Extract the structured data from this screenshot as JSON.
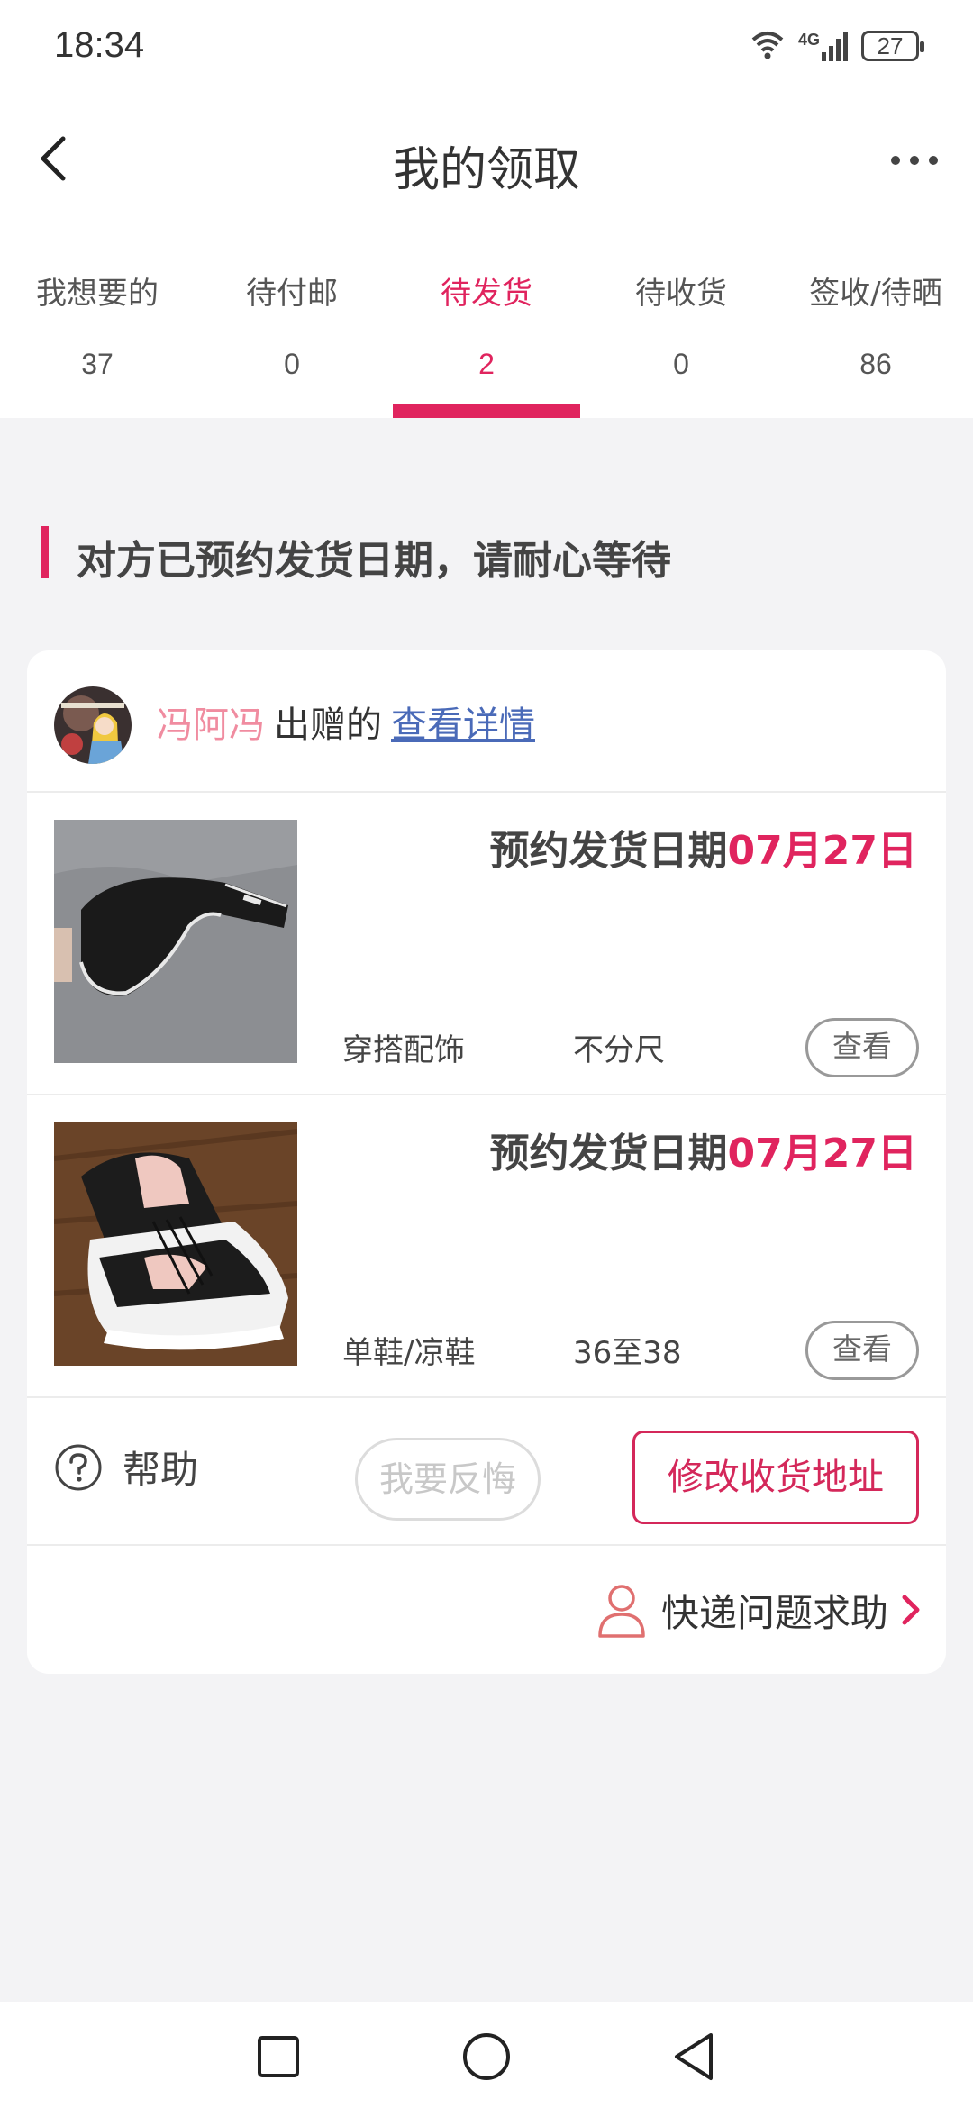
{
  "status_bar": {
    "time": "18:34",
    "network": "4G",
    "battery": "27"
  },
  "header": {
    "title": "我的领取"
  },
  "tabs": [
    {
      "label": "我想要的",
      "count": "37"
    },
    {
      "label": "待付邮",
      "count": "0"
    },
    {
      "label": "待发货",
      "count": "2",
      "active": true
    },
    {
      "label": "待收货",
      "count": "0"
    },
    {
      "label": "签收/待晒",
      "count": "86"
    }
  ],
  "notice": "对方已预约发货日期，请耐心等待",
  "card": {
    "giver_name": "冯阿冯",
    "giver_text": "出赠的",
    "detail_link": "查看详情",
    "items": [
      {
        "date_label": "预约发货日期",
        "date_value": "07月27日",
        "category": "穿搭配饰",
        "size": "不分尺",
        "view_label": "查看",
        "thumb_icon": "visor-cap-photo"
      },
      {
        "date_label": "预约发货日期",
        "date_value": "07月27日",
        "category": "单鞋/凉鞋",
        "size": "36至38",
        "view_label": "查看",
        "thumb_icon": "sneakers-photo"
      }
    ],
    "help_label": "帮助",
    "regret_label": "我要反悔",
    "address_label": "修改收货地址",
    "courier_label": "快递问题求助"
  },
  "colors": {
    "accent": "#e0245e",
    "link": "#4a6ab8",
    "giver": "#f08ca0",
    "background": "#f3f3f5"
  }
}
